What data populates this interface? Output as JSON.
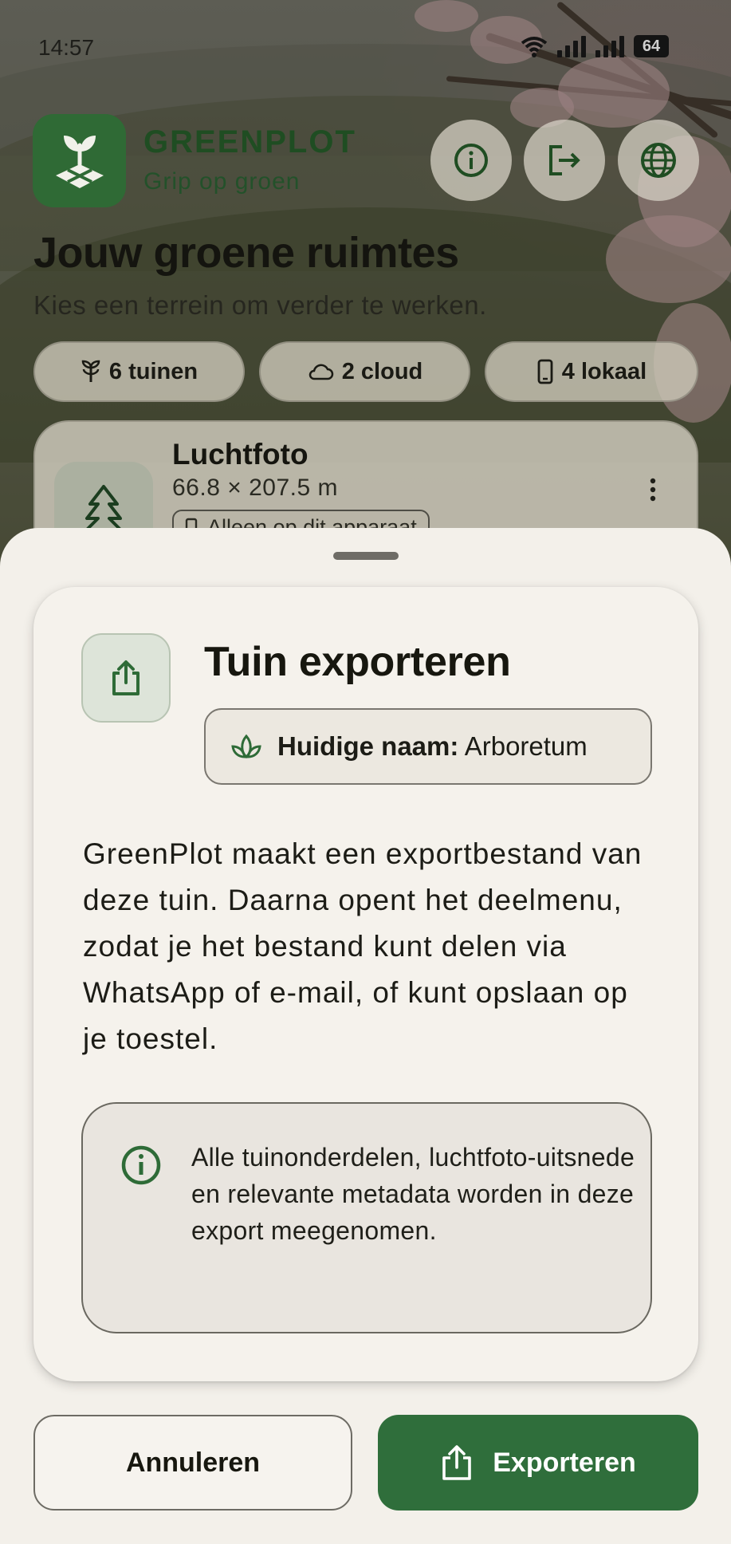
{
  "status_bar": {
    "time": "14:57",
    "battery": "64"
  },
  "header": {
    "brand_name": "GREENPLOT",
    "tagline": "Grip op groen",
    "title": "Jouw groene ruimtes",
    "subtitle": "Kies een terrein om verder te werken.",
    "actions": [
      {
        "icon": "info-icon"
      },
      {
        "icon": "logout-icon"
      },
      {
        "icon": "globe-icon"
      }
    ]
  },
  "filters": [
    {
      "icon": "plant-icon",
      "label": "6 tuinen"
    },
    {
      "icon": "cloud-icon",
      "label": "2 cloud"
    },
    {
      "icon": "phone-icon",
      "label": "4 lokaal"
    }
  ],
  "garden": {
    "name": "Luchtfoto",
    "size": "66.8 × 207.5 m",
    "tag": "Alleen op dit apparaat",
    "icon": "tree-icon"
  },
  "sheet": {
    "title": "Tuin exporteren",
    "name_label": "Huidige naam:",
    "name_value": "Arboretum",
    "description": "GreenPlot maakt een exportbestand van deze tuin. Daarna opent het deelmenu, zodat je het bestand kunt delen via WhatsApp of e-mail, of kunt opslaan op je toestel.",
    "info": "Alle tuinonderdelen, luchtfoto-uitsnede en relevante metadata worden in deze export meegenomen.",
    "cancel_label": "Annuleren",
    "export_label": "Exporteren"
  },
  "colors": {
    "brand_green": "#2f6a35",
    "export_button": "#2f6e3b",
    "sheet_background": "#f3f0ea"
  }
}
